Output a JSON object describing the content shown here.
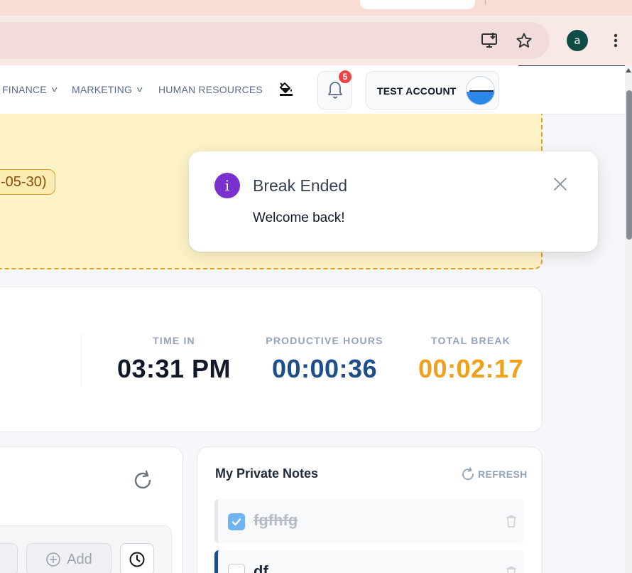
{
  "header": {
    "nav_items": [
      {
        "label": "FINANCE"
      },
      {
        "label": "MARKETING"
      },
      {
        "label": "HUMAN RESOURCES"
      }
    ],
    "notification_count": "5",
    "account_label": "TEST ACCOUNT",
    "browser_avatar_letter": "a"
  },
  "notice": {
    "date_text": "-05-30)"
  },
  "stats": {
    "time_in_label": "TIME IN",
    "time_in_value": "03:31 PM",
    "productive_label": "PRODUCTIVE HOURS",
    "productive_value": "00:00:36",
    "break_label": "TOTAL BREAK",
    "break_value": "00:02:17"
  },
  "actions": {
    "add_label": "Add"
  },
  "notes": {
    "title": "My Private Notes",
    "refresh_label": "REFRESH",
    "items": [
      {
        "text": "fgfhfg",
        "done": true
      },
      {
        "text": "df",
        "done": false
      }
    ]
  },
  "toast": {
    "title": "Break Ended",
    "message": "Welcome back!"
  },
  "colors": {
    "accent_purple": "#7a2fcf",
    "productive_blue": "#1d4e89",
    "break_orange": "#f0a01a",
    "badge_red": "#ef4444"
  },
  "icons": [
    "install-app-icon",
    "star-icon",
    "more-menu-icon",
    "paint-bucket-icon",
    "bell-icon",
    "refresh-icon",
    "add-circle-icon",
    "clock-icon",
    "check-icon",
    "trash-icon",
    "info-icon",
    "close-icon"
  ]
}
